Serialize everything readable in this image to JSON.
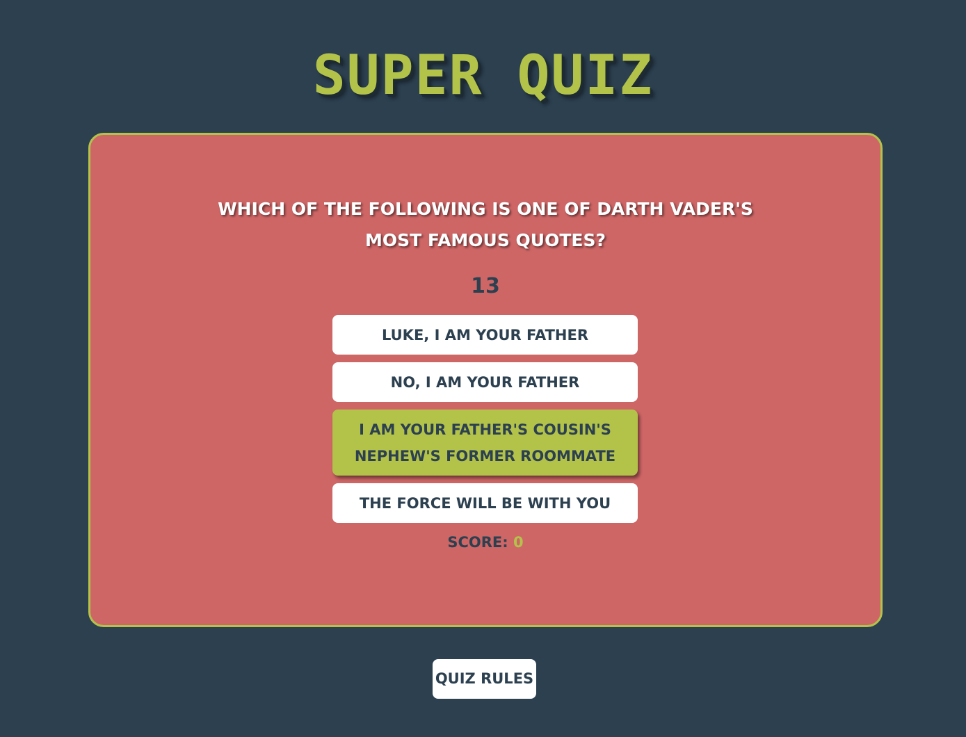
{
  "app": {
    "title": "SUPER QUIZ"
  },
  "quiz": {
    "question": "WHICH OF THE FOLLOWING IS ONE OF DARTH VADER'S MOST FAMOUS QUOTES?",
    "timer": "13",
    "answers": [
      {
        "label": "LUKE, I AM YOUR FATHER",
        "selected": false
      },
      {
        "label": "NO, I AM YOUR FATHER",
        "selected": false
      },
      {
        "label": "I AM YOUR FATHER'S COUSIN'S NEPHEW'S FORMER ROOMMATE",
        "selected": true
      },
      {
        "label": "THE FORCE WILL BE WITH YOU",
        "selected": false
      }
    ],
    "score_label": "SCORE:",
    "score_value": "0"
  },
  "footer": {
    "rules_label": "QUIZ RULES"
  },
  "colors": {
    "background": "#2c4050",
    "card": "#cf6666",
    "accent": "#b3c34a",
    "button": "#ffffff",
    "text_dark": "#2c4050"
  }
}
